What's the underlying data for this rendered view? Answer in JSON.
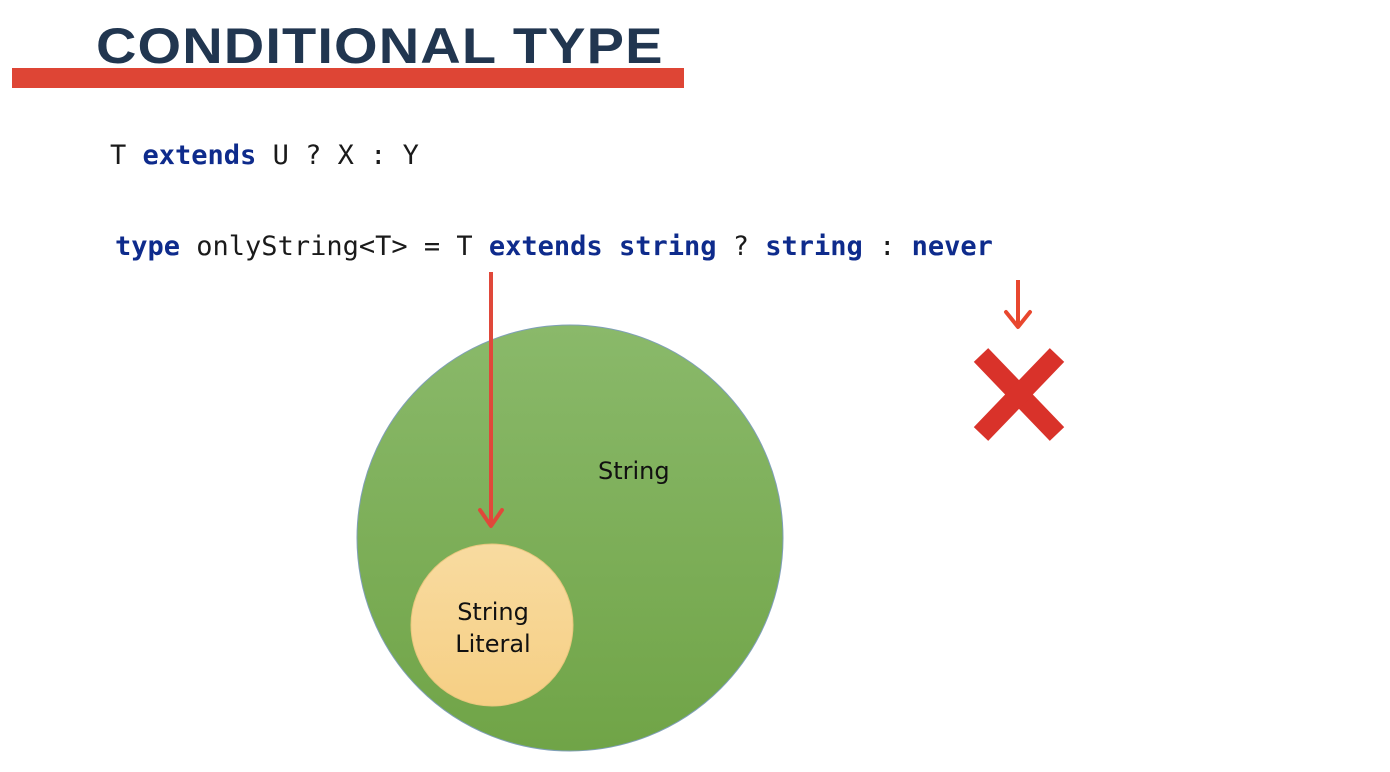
{
  "title": "CONDITIONAL TYPE",
  "colors": {
    "title": "#213650",
    "underline": "#de4535",
    "keyword": "#0e2b8c",
    "arrow": "#e0483a",
    "outer_circle": "#7dae55",
    "inner_circle": "#f8d697",
    "cross": "#d9322a"
  },
  "code": {
    "line1": {
      "t": "T ",
      "kw_extends": "extends",
      "rest": " U ? X : Y"
    },
    "line2": {
      "kw_type": "type",
      "name": " onlyString<T> = T ",
      "kw_extends": "extends",
      "sp1": " ",
      "kw_string1": "string",
      "q": " ? ",
      "kw_string2": "string",
      "colon": " : ",
      "kw_never": "never"
    }
  },
  "diagram": {
    "outer_label": "String",
    "inner_label_line1": "String",
    "inner_label_line2": "Literal",
    "rejected_icon": "cross-icon"
  }
}
